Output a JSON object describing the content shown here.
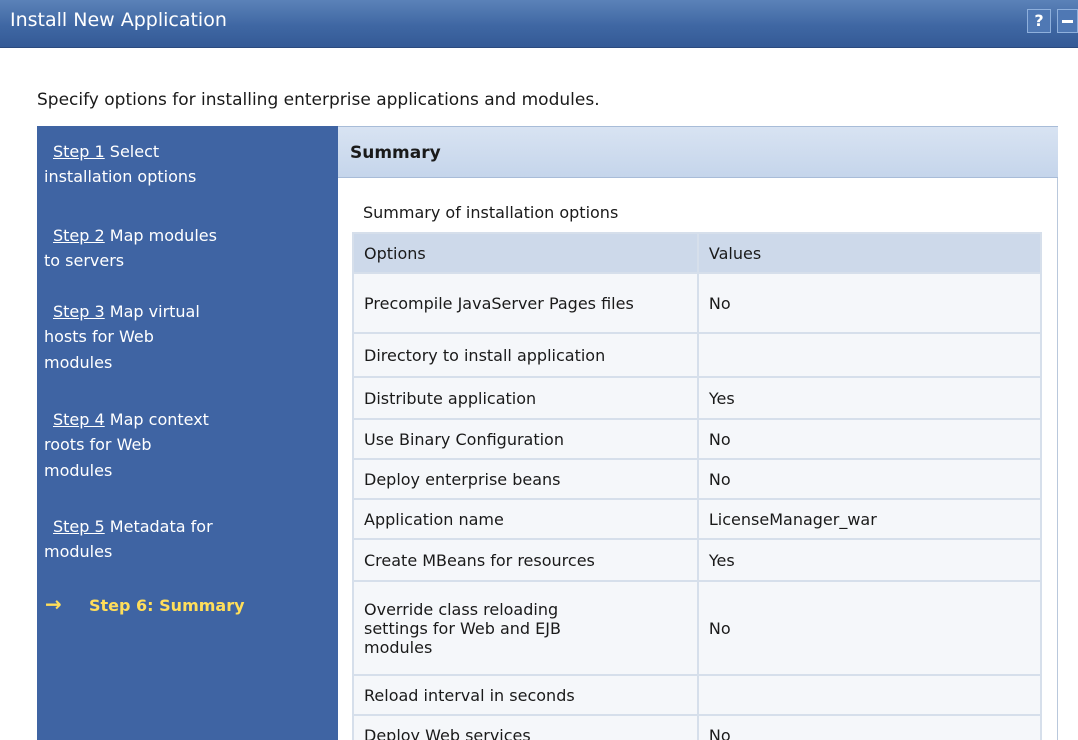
{
  "window": {
    "title": "Install New Application",
    "help_label": "?"
  },
  "intro": "Specify options for installing enterprise applications and modules.",
  "nav": {
    "steps": [
      {
        "link": "Step 1",
        "line1": "Select",
        "line2": "installation options"
      },
      {
        "link": "Step 2",
        "line1": "Map modules",
        "line2": "to servers"
      },
      {
        "link": "Step 3",
        "line1": "Map virtual",
        "line2": "hosts for Web",
        "line3": "modules"
      },
      {
        "link": "Step 4",
        "line1": "Map context",
        "line2": "roots for Web",
        "line3": "modules"
      },
      {
        "link": "Step 5",
        "line1": "Metadata for",
        "line2": "modules"
      }
    ],
    "current": "Step 6: Summary",
    "current_indicator": "→"
  },
  "summary": {
    "header": "Summary",
    "caption": "Summary of installation options",
    "columns": [
      "Options",
      "Values"
    ],
    "rows": [
      {
        "option": "Precompile JavaServer Pages files",
        "value": "No"
      },
      {
        "option": "Directory to install application",
        "value": ""
      },
      {
        "option": "Distribute application",
        "value": "Yes"
      },
      {
        "option": "Use Binary Configuration",
        "value": "No"
      },
      {
        "option": "Deploy enterprise beans",
        "value": "No"
      },
      {
        "option": "Application name",
        "value": "LicenseManager_war"
      },
      {
        "option": "Create MBeans for resources",
        "value": "Yes"
      },
      {
        "option": "Override class reloading settings for Web and EJB modules",
        "value": "No"
      },
      {
        "option": "Reload interval in seconds",
        "value": ""
      },
      {
        "option": "Deploy Web services",
        "value": "No"
      }
    ]
  }
}
